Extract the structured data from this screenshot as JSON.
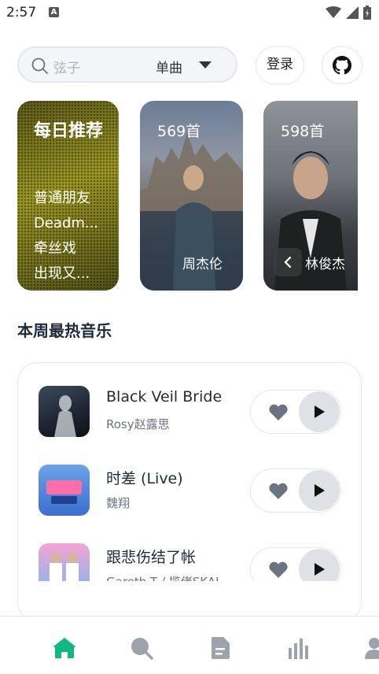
{
  "status_bar": {
    "time": "2:57",
    "notification_letter": "A"
  },
  "search": {
    "placeholder": "弦子",
    "type_label": "单曲"
  },
  "header": {
    "login_label": "登录"
  },
  "daily_card": {
    "title": "每日推荐",
    "songs": [
      "普通朋友",
      "Deadm...",
      "牵丝戏",
      "出现又..."
    ]
  },
  "artist_cards": [
    {
      "count": "569首",
      "name": "周杰伦"
    },
    {
      "count": "598首",
      "name": "林俊杰"
    }
  ],
  "section": {
    "title": "本周最热音乐"
  },
  "hot_songs": [
    {
      "title": "Black Veil Bride",
      "artist": "Rosy赵露思"
    },
    {
      "title": "时差 (Live)",
      "artist": "魏翔"
    },
    {
      "title": "跟悲伤结了帐",
      "artist": "Gareth.T / 揽佬SKAI"
    }
  ],
  "colors": {
    "accent": "#10b981",
    "icon_gray": "#9ca3af",
    "play_bg": "#dfe1e6"
  },
  "bottom_nav": [
    "home-icon",
    "search-icon",
    "document-icon",
    "chart-icon",
    "user-icon"
  ]
}
